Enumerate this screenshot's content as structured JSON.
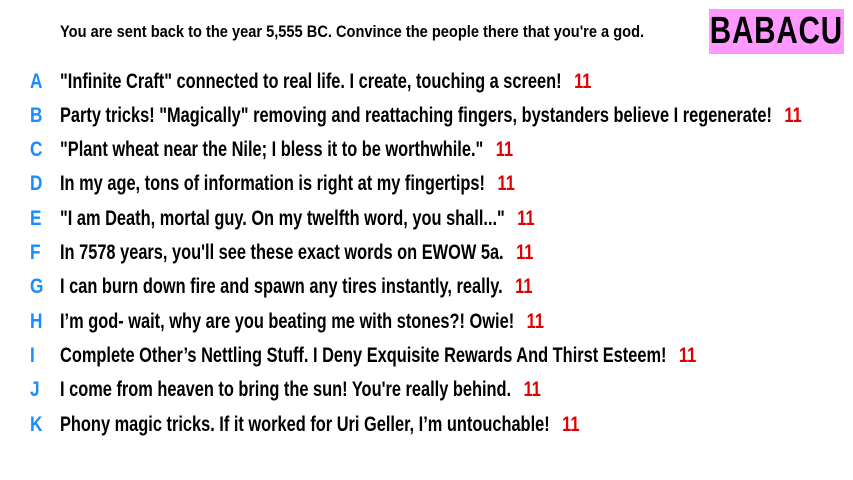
{
  "prompt": "You are sent back to the year 5,555 BC. Convince the people there that you're a god.",
  "badge": "BABACU",
  "colors": {
    "letter": "#1a8cff",
    "score": "#e00000",
    "badge_bg": "#ff99ff"
  },
  "responses": [
    {
      "letter": "A",
      "text": "\"Infinite Craft\" connected to real life. I create, touching a screen!",
      "score": "11"
    },
    {
      "letter": "B",
      "text": "Party tricks! \"Magically\" removing and reattaching fingers, bystanders believe I regenerate!",
      "score": "11"
    },
    {
      "letter": "C",
      "text": "\"Plant wheat near the Nile; I bless it to be worthwhile.\"",
      "score": "11"
    },
    {
      "letter": "D",
      "text": "In my age, tons of information is right at my fingertips!",
      "score": "11"
    },
    {
      "letter": "E",
      "text": "\"I am Death, mortal guy. On my twelfth word, you shall...\"",
      "score": "11"
    },
    {
      "letter": "F",
      "text": "In 7578 years, you'll see these exact words on EWOW 5a.",
      "score": "11"
    },
    {
      "letter": "G",
      "text": "I can burn down fire and spawn any tires instantly, really.",
      "score": "11"
    },
    {
      "letter": "H",
      "text": "I’m god- wait, why are you beating me with stones?! Owie!",
      "score": "11"
    },
    {
      "letter": "I",
      "text": "Complete Other’s Nettling Stuff. I Deny Exquisite Rewards And Thirst Esteem!",
      "score": "11"
    },
    {
      "letter": "J",
      "text": "I come from heaven to bring the sun! You're really behind.",
      "score": "11"
    },
    {
      "letter": "K",
      "text": "Phony magic tricks. If it worked for Uri Geller, I’m untouchable!",
      "score": "11"
    }
  ]
}
